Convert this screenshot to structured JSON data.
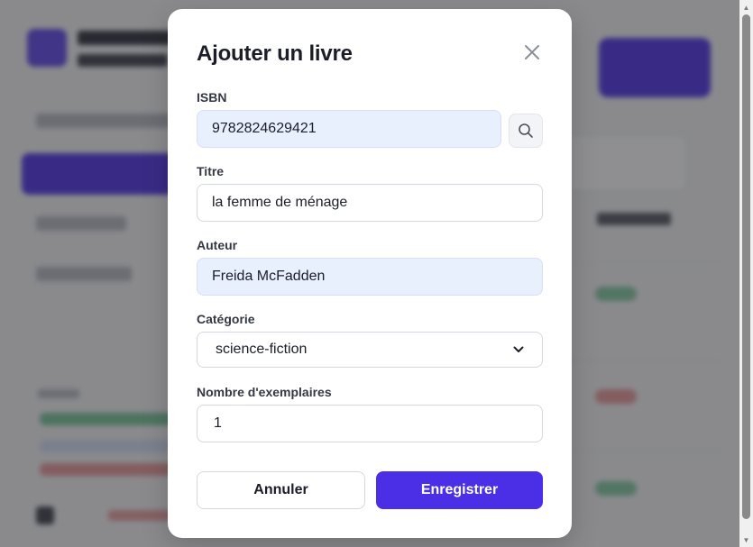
{
  "modal": {
    "title": "Ajouter un livre",
    "fields": {
      "isbn": {
        "label": "ISBN",
        "value": "9782824629421"
      },
      "title": {
        "label": "Titre",
        "value": "la femme de ménage"
      },
      "author": {
        "label": "Auteur",
        "value": "Freida McFadden"
      },
      "category": {
        "label": "Catégorie",
        "value": "science-fiction"
      },
      "copies": {
        "label": "Nombre d'exemplaires",
        "value": "1"
      }
    },
    "buttons": {
      "cancel": "Annuler",
      "save": "Enregistrer"
    }
  },
  "icons": {
    "close": "close-icon",
    "search": "search-icon",
    "select_arrow": "chevron-down-icon"
  },
  "colors": {
    "accent": "#4b2fe6",
    "autofill_bg": "#e8f0fe",
    "overlay": "rgba(40,40,44,0.52)"
  }
}
